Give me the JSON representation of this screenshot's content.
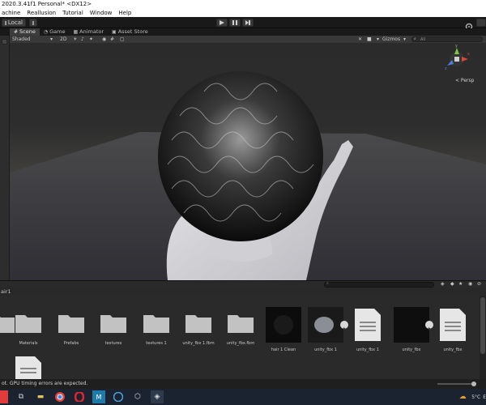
{
  "window": {
    "title": "2020.3.41f1 Personal* <DX12>"
  },
  "menu": [
    "achine",
    "Reallusion",
    "Tutorial",
    "Window",
    "Help"
  ],
  "toolbar": {
    "local_label": "Local",
    "play_icon": "play-icon",
    "pause_icon": "pause-icon",
    "step_icon": "step-icon"
  },
  "tabs": [
    {
      "label": "Scene",
      "icon": "grid-icon",
      "active": true
    },
    {
      "label": "Game",
      "icon": "pacman-icon",
      "active": false
    },
    {
      "label": "Animator",
      "icon": "animator-icon",
      "active": false
    },
    {
      "label": "Asset Store",
      "icon": "bag-icon",
      "active": false
    }
  ],
  "scene": {
    "shading_mode": "Shaded",
    "dimension_toggle": "2D",
    "gizmos_label": "Gizmos",
    "search_placeholder": "All",
    "persp_label": "< Persp",
    "axis_x": "x",
    "axis_y": "y",
    "axis_z": "z"
  },
  "project": {
    "path_fragment": "air1",
    "items": [
      {
        "label": "",
        "kind": "folder"
      },
      {
        "label": "Materials",
        "kind": "folder"
      },
      {
        "label": "Prefabs",
        "kind": "folder"
      },
      {
        "label": "textures",
        "kind": "folder"
      },
      {
        "label": "textures 1",
        "kind": "folder"
      },
      {
        "label": "unity_fbx 1.fbm",
        "kind": "folder"
      },
      {
        "label": "unity_fbx.fbm",
        "kind": "folder"
      },
      {
        "label": "hair 1 Clean",
        "kind": "preview"
      },
      {
        "label": "unity_fbx 1",
        "kind": "model"
      },
      {
        "label": "unity_fbx 1",
        "kind": "file"
      },
      {
        "label": "unity_fbx",
        "kind": "model-dark"
      },
      {
        "label": "unity_fbx",
        "kind": "file"
      },
      {
        "label": "",
        "kind": "file"
      }
    ]
  },
  "status": {
    "message": "ot. GPU timing errors are expected."
  },
  "taskbar": {
    "temperature": "5°C",
    "extra": "E"
  },
  "colors": {
    "accent_blue": "#2f6fd6",
    "panel_dark": "#191919",
    "panel_mid": "#2a2a2a"
  }
}
